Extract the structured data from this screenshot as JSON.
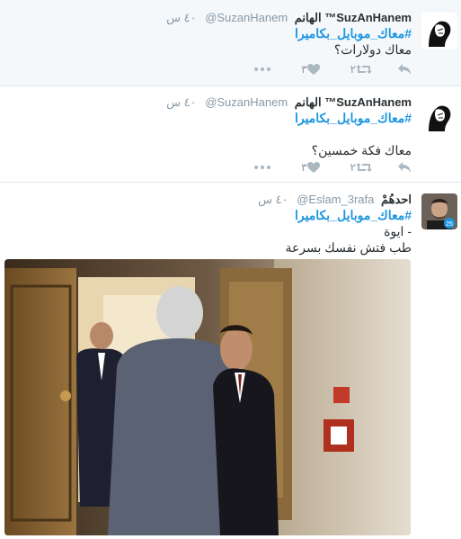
{
  "tweets": [
    {
      "fullname": "SuzAnHanem™ الهانم",
      "username": "@SuzanHanem",
      "time": "٤٠ س",
      "hashtag": "#معاك_موبايل_بكاميرا",
      "text": "معاك دولارات؟",
      "retweets": "٢",
      "likes": "٣"
    },
    {
      "fullname": "SuzAnHanem™ الهانم",
      "username": "@SuzanHanem",
      "time": "٤٠ س",
      "hashtag": "#معاك_موبايل_بكاميرا",
      "text": "معاك فكة خمسين؟",
      "retweets": "٢",
      "likes": "٣"
    },
    {
      "fullname": "احدهُمْ",
      "username": "@Eslam_3rafa",
      "time": "٤٠ س",
      "hashtag": "#معاك_موبايل_بكاميرا",
      "text_line1": "- ايوة",
      "text_line2": "طب فتش نفسك بسرعة"
    }
  ],
  "colors": {
    "link": "#1b95e0",
    "muted": "#8899a6",
    "action_icon": "#aab8c2"
  },
  "icons": [
    "reply-icon",
    "retweet-icon",
    "like-icon",
    "more-icon"
  ]
}
